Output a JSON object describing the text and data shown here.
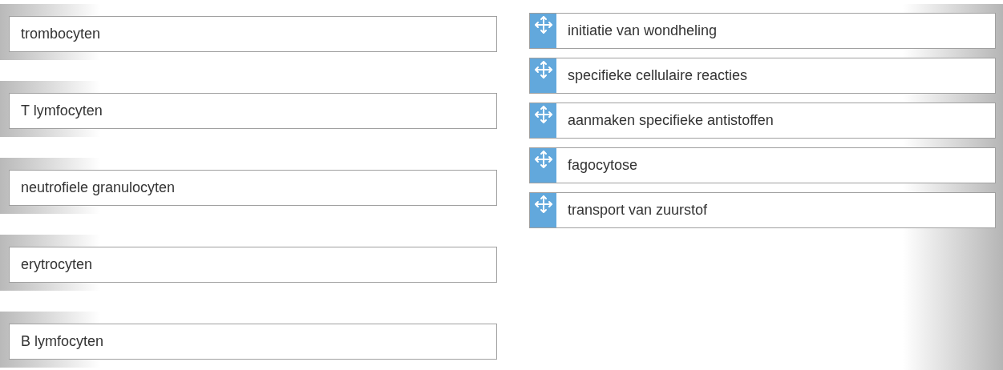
{
  "targets": [
    {
      "label": "trombocyten"
    },
    {
      "label": "T lymfocyten"
    },
    {
      "label": "neutrofiele granulocyten"
    },
    {
      "label": "erytrocyten"
    },
    {
      "label": "B lymfocyten"
    }
  ],
  "options": [
    {
      "label": "initiatie van wondheling"
    },
    {
      "label": "specifieke cellulaire reacties"
    },
    {
      "label": "aanmaken specifieke antistoffen"
    },
    {
      "label": "fagocytose"
    },
    {
      "label": "transport van zuurstof"
    }
  ]
}
